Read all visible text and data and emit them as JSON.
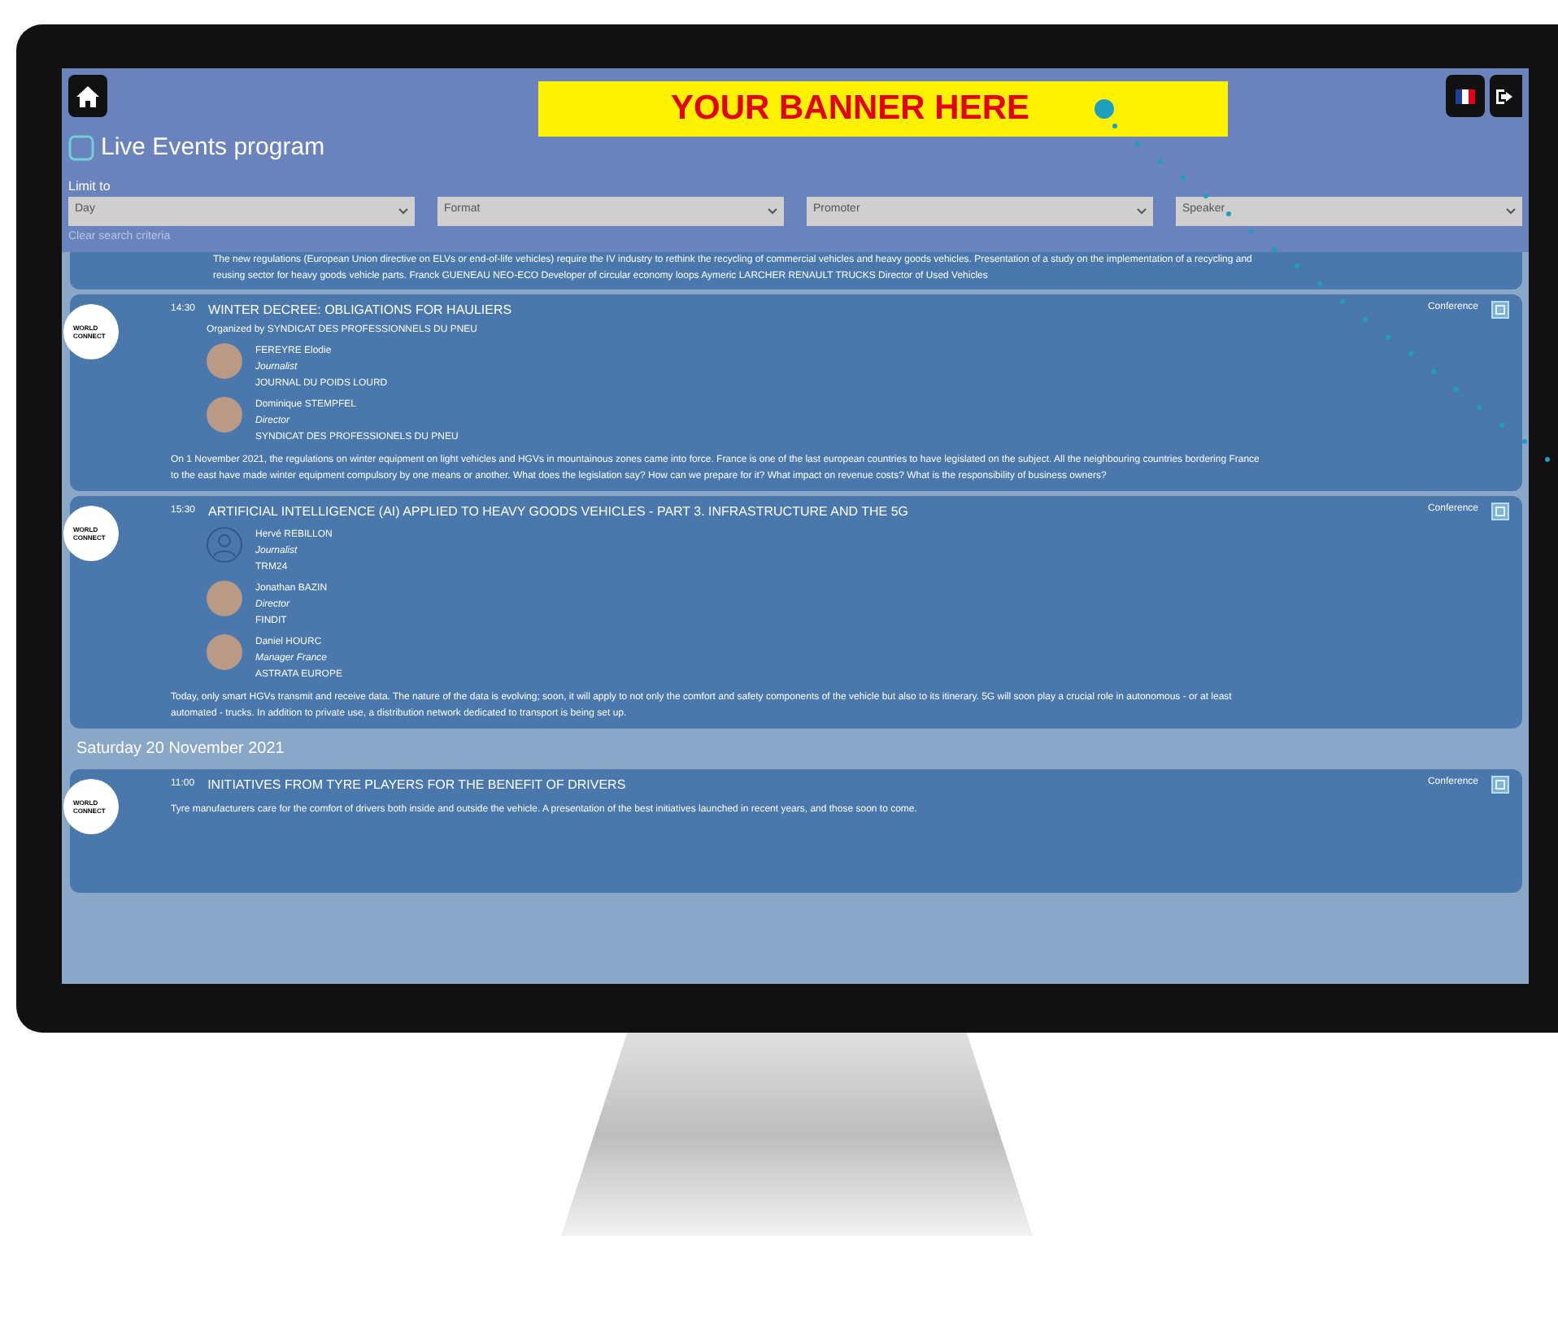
{
  "banner": {
    "text": "YOUR BANNER HERE"
  },
  "header": {
    "title": "Live Events program",
    "limit_label": "Limit to",
    "clear_link": "Clear search criteria"
  },
  "filters": [
    {
      "placeholder": "Day"
    },
    {
      "placeholder": "Format"
    },
    {
      "placeholder": "Promoter"
    },
    {
      "placeholder": "Speaker"
    }
  ],
  "partial_event": {
    "description": "The new regulations (European Union directive on ELVs or end-of-life vehicles) require the IV industry to rethink the recycling of commercial vehicles and heavy goods vehicles. Presentation of a study on the implementation of a recycling and reusing sector for heavy goods vehicle parts. Franck GUENEAU NEO-ECO Developer of circular economy loops Aymeric LARCHER RENAULT TRUCKS Director of Used Vehicles"
  },
  "sections": [
    {
      "events": [
        {
          "logo_text": "WORLD CONNECT",
          "time": "14:30",
          "title": "WINTER DECREE: OBLIGATIONS FOR HAULIERS",
          "organizer": "Organized by SYNDICAT DES PROFESSIONNELS DU PNEU",
          "format": "Conference",
          "speakers": [
            {
              "kind": "photo",
              "name": "FEREYRE Elodie",
              "role": "Journalist",
              "company": "JOURNAL DU POIDS LOURD"
            },
            {
              "kind": "photo",
              "name": "Dominique STEMPFEL",
              "role": "Director",
              "company": "SYNDICAT DES PROFESSIONELS DU PNEU"
            }
          ],
          "description": "On 1 November 2021, the regulations on winter equipment on light vehicles and HGVs in mountainous zones came into force. France is one of the last european countries to have legislated on the subject. All the neighbouring countries bordering France to the east have made winter equipment compulsory by one means or another. What does the legislation say? How can we prepare for it? What impact on revenue costs? What is the responsibility of business owners?"
        },
        {
          "logo_text": "WORLD CONNECT",
          "time": "15:30",
          "title": "ARTIFICIAL INTELLIGENCE (AI) APPLIED TO HEAVY GOODS VEHICLES - PART 3. INFRASTRUCTURE AND THE 5G",
          "format": "Conference",
          "speakers": [
            {
              "kind": "silhouette",
              "name": "Hervé REBILLON",
              "role": "Journalist",
              "company": "TRM24"
            },
            {
              "kind": "photo",
              "name": "Jonathan BAZIN",
              "role": "Director",
              "company": "FINDIT"
            },
            {
              "kind": "photo",
              "name": "Daniel HOURC",
              "role": "Manager France",
              "company": "ASTRATA EUROPE"
            }
          ],
          "description": "Today, only smart HGVs transmit and receive data. The nature of the data is evolving; soon, it will apply to not only the comfort and safety components of the vehicle but also to its itinerary. 5G will soon play a crucial role in autonomous - or at least automated - trucks. In addition to private use, a distribution network dedicated to transport is being set up."
        }
      ]
    },
    {
      "date": "Saturday 20 November 2021",
      "events": [
        {
          "logo_text": "WORLD CONNECT",
          "time": "11:00",
          "title": "INITIATIVES FROM TYRE PLAYERS FOR THE BENEFIT OF DRIVERS",
          "format": "Conference",
          "description": "Tyre manufacturers care for the comfort of drivers both inside and outside the vehicle. A presentation of the best initiatives launched in recent years, and those soon to come."
        }
      ]
    }
  ]
}
